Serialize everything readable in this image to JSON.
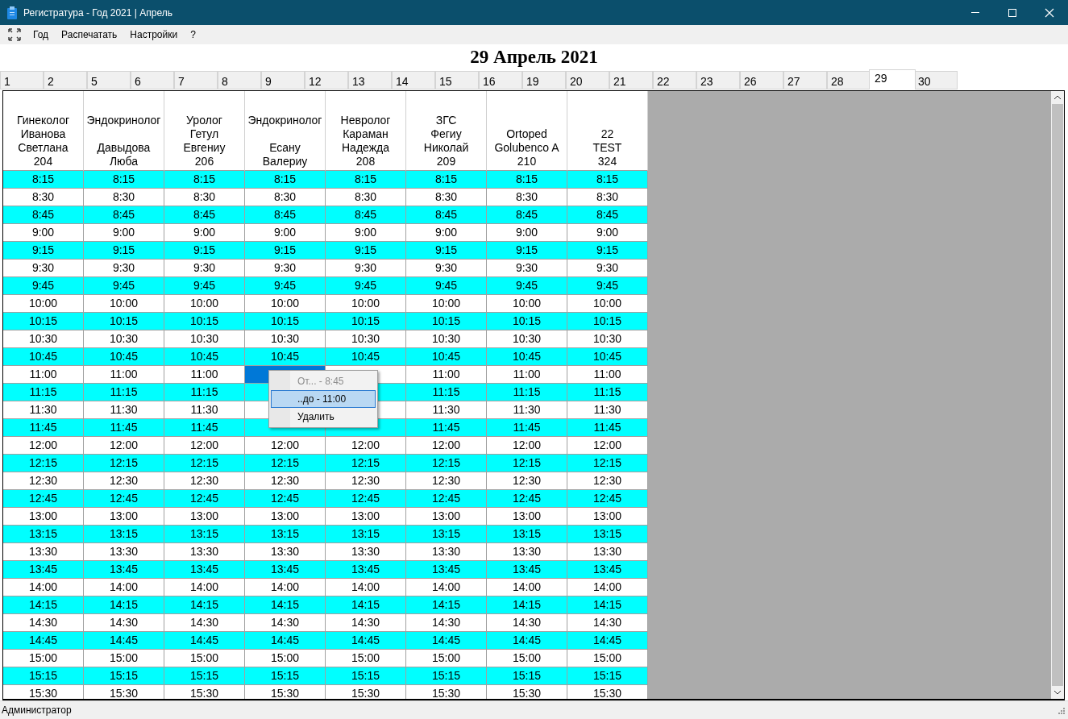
{
  "window": {
    "title": "Регистратура - Год 2021 | Апрель"
  },
  "menu": [
    "Год",
    "Распечатать",
    "Настройки",
    "?"
  ],
  "date_title": "29 Апрель 2021",
  "tabs": [
    {
      "label": "1",
      "selected": false
    },
    {
      "label": "2",
      "selected": false
    },
    {
      "label": "5",
      "selected": false
    },
    {
      "label": "6",
      "selected": false
    },
    {
      "label": "7",
      "selected": false
    },
    {
      "label": "8",
      "selected": false
    },
    {
      "label": "9",
      "selected": false
    },
    {
      "label": "12",
      "selected": false
    },
    {
      "label": "13",
      "selected": false
    },
    {
      "label": "14",
      "selected": false
    },
    {
      "label": "15",
      "selected": false
    },
    {
      "label": "16",
      "selected": false
    },
    {
      "label": "19",
      "selected": false
    },
    {
      "label": "20",
      "selected": false
    },
    {
      "label": "21",
      "selected": false
    },
    {
      "label": "22",
      "selected": false
    },
    {
      "label": "23",
      "selected": false
    },
    {
      "label": "26",
      "selected": false
    },
    {
      "label": "27",
      "selected": false
    },
    {
      "label": "28",
      "selected": false
    },
    {
      "label": "29",
      "selected": true
    },
    {
      "label": "30",
      "selected": false
    }
  ],
  "columns": [
    {
      "header": "Гинеколог\nИванова\nСветлана\n204",
      "selected": false
    },
    {
      "header": "Эндокринолог\n\nДавыдова\nЛюба",
      "selected": false
    },
    {
      "header": "Уролог\nГетул\nЕвгениу\n206",
      "selected": false
    },
    {
      "header": "Эндокринолог\n\nЕсану\nВалериу",
      "selected": true
    },
    {
      "header": "Невролог\nКараман\nНадежда\n208",
      "selected": false
    },
    {
      "header": "ЗГС\nФегиу\nНиколай\n209",
      "selected": false
    },
    {
      "header": "Ortoped\nGolubenco A\n210",
      "selected": false
    },
    {
      "header": "22\nTEST\n324",
      "selected": false
    }
  ],
  "rows": [
    {
      "cells": [
        "8:15",
        "8:15",
        "8:15",
        "8:15",
        "8:15",
        "8:15",
        "8:15",
        "8:15"
      ],
      "selected": false
    },
    {
      "cells": [
        "8:30",
        "8:30",
        "8:30",
        "8:30",
        "8:30",
        "8:30",
        "8:30",
        "8:30"
      ],
      "selected": false
    },
    {
      "cells": [
        "8:45",
        "8:45",
        "8:45",
        "8:45",
        "8:45",
        "8:45",
        "8:45",
        "8:45"
      ],
      "selected": false
    },
    {
      "cells": [
        "9:00",
        "9:00",
        "9:00",
        "9:00",
        "9:00",
        "9:00",
        "9:00",
        "9:00"
      ],
      "selected": false
    },
    {
      "cells": [
        "9:15",
        "9:15",
        "9:15",
        "9:15",
        "9:15",
        "9:15",
        "9:15",
        "9:15"
      ],
      "selected": false
    },
    {
      "cells": [
        "9:30",
        "9:30",
        "9:30",
        "9:30",
        "9:30",
        "9:30",
        "9:30",
        "9:30"
      ],
      "selected": false
    },
    {
      "cells": [
        "9:45",
        "9:45",
        "9:45",
        "9:45",
        "9:45",
        "9:45",
        "9:45",
        "9:45"
      ],
      "selected": false
    },
    {
      "cells": [
        "10:00",
        "10:00",
        "10:00",
        "10:00",
        "10:00",
        "10:00",
        "10:00",
        "10:00"
      ],
      "selected": false
    },
    {
      "cells": [
        "10:15",
        "10:15",
        "10:15",
        "10:15",
        "10:15",
        "10:15",
        "10:15",
        "10:15"
      ],
      "selected": false
    },
    {
      "cells": [
        "10:30",
        "10:30",
        "10:30",
        "10:30",
        "10:30",
        "10:30",
        "10:30",
        "10:30"
      ],
      "selected": false
    },
    {
      "cells": [
        "10:45",
        "10:45",
        "10:45",
        "10:45",
        "10:45",
        "10:45",
        "10:45",
        "10:45"
      ],
      "selected": false
    },
    {
      "cells": [
        "11:00",
        "11:00",
        "11:00",
        null,
        null,
        "11:00",
        "11:00",
        "11:00"
      ],
      "selected": true
    },
    {
      "cells": [
        "11:15",
        "11:15",
        "11:15",
        null,
        null,
        "11:15",
        "11:15",
        "11:15"
      ],
      "selected": false
    },
    {
      "cells": [
        "11:30",
        "11:30",
        "11:30",
        null,
        null,
        "11:30",
        "11:30",
        "11:30"
      ],
      "selected": false
    },
    {
      "cells": [
        "11:45",
        "11:45",
        "11:45",
        null,
        null,
        "11:45",
        "11:45",
        "11:45"
      ],
      "selected": false
    },
    {
      "cells": [
        "12:00",
        "12:00",
        "12:00",
        "12:00",
        "12:00",
        "12:00",
        "12:00",
        "12:00"
      ],
      "selected": false
    },
    {
      "cells": [
        "12:15",
        "12:15",
        "12:15",
        "12:15",
        "12:15",
        "12:15",
        "12:15",
        "12:15"
      ],
      "selected": false
    },
    {
      "cells": [
        "12:30",
        "12:30",
        "12:30",
        "12:30",
        "12:30",
        "12:30",
        "12:30",
        "12:30"
      ],
      "selected": false
    },
    {
      "cells": [
        "12:45",
        "12:45",
        "12:45",
        "12:45",
        "12:45",
        "12:45",
        "12:45",
        "12:45"
      ],
      "selected": false
    },
    {
      "cells": [
        "13:00",
        "13:00",
        "13:00",
        "13:00",
        "13:00",
        "13:00",
        "13:00",
        "13:00"
      ],
      "selected": false
    },
    {
      "cells": [
        "13:15",
        "13:15",
        "13:15",
        "13:15",
        "13:15",
        "13:15",
        "13:15",
        "13:15"
      ],
      "selected": false
    },
    {
      "cells": [
        "13:30",
        "13:30",
        "13:30",
        "13:30",
        "13:30",
        "13:30",
        "13:30",
        "13:30"
      ],
      "selected": false
    },
    {
      "cells": [
        "13:45",
        "13:45",
        "13:45",
        "13:45",
        "13:45",
        "13:45",
        "13:45",
        "13:45"
      ],
      "selected": false
    },
    {
      "cells": [
        "14:00",
        "14:00",
        "14:00",
        "14:00",
        "14:00",
        "14:00",
        "14:00",
        "14:00"
      ],
      "selected": false
    },
    {
      "cells": [
        "14:15",
        "14:15",
        "14:15",
        "14:15",
        "14:15",
        "14:15",
        "14:15",
        "14:15"
      ],
      "selected": false
    },
    {
      "cells": [
        "14:30",
        "14:30",
        "14:30",
        "14:30",
        "14:30",
        "14:30",
        "14:30",
        "14:30"
      ],
      "selected": false
    },
    {
      "cells": [
        "14:45",
        "14:45",
        "14:45",
        "14:45",
        "14:45",
        "14:45",
        "14:45",
        "14:45"
      ],
      "selected": false
    },
    {
      "cells": [
        "15:00",
        "15:00",
        "15:00",
        "15:00",
        "15:00",
        "15:00",
        "15:00",
        "15:00"
      ],
      "selected": false
    },
    {
      "cells": [
        "15:15",
        "15:15",
        "15:15",
        "15:15",
        "15:15",
        "15:15",
        "15:15",
        "15:15"
      ],
      "selected": false
    },
    {
      "cells": [
        "15:30",
        "15:30",
        "15:30",
        "15:30",
        "15:30",
        "15:30",
        "15:30",
        "15:30"
      ],
      "selected": false
    }
  ],
  "context_menu": [
    {
      "label": "От... - 8:45",
      "disabled": true,
      "selected": false
    },
    {
      "label": "..до - 11:00",
      "disabled": false,
      "selected": true
    },
    {
      "label": "Удалить",
      "disabled": false,
      "selected": false
    }
  ],
  "status_bar": "Администратор"
}
